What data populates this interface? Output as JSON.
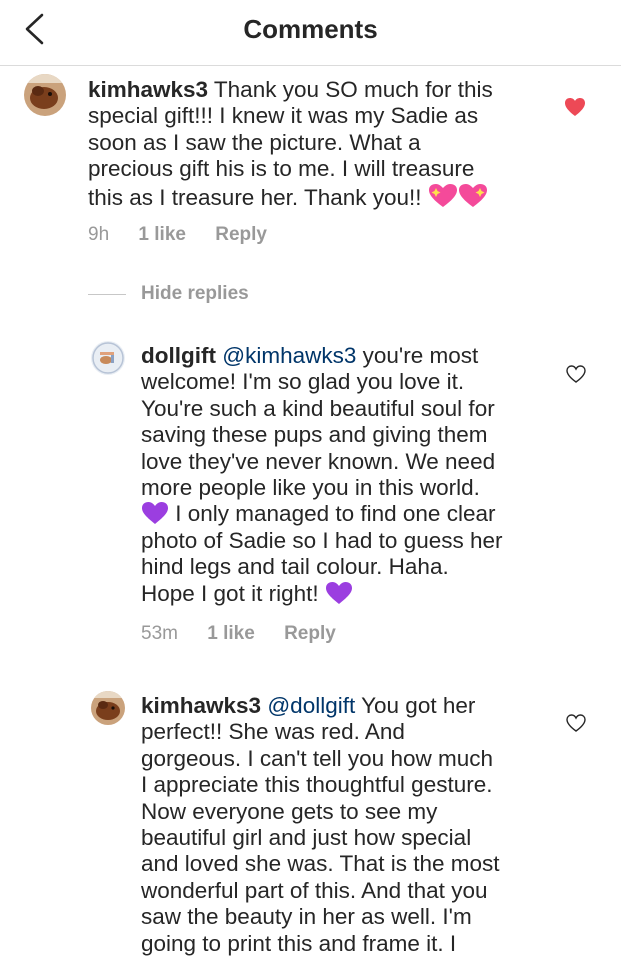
{
  "header": {
    "title": "Comments",
    "back_icon": "chevron-left-icon"
  },
  "comments": [
    {
      "username": "kimhawks3",
      "lines": [
        " Thank you SO much for this",
        "special gift!!! I knew it was my Sadie as",
        "soon as I saw the picture. What a",
        "precious gift his is to me. I will treasure",
        "this as I treasure her. Thank you!! "
      ],
      "emoji": "sparkling-heart-icon",
      "time": "9h",
      "likes": "1 like",
      "reply": "Reply",
      "liked": true,
      "heart_color": "#ed4956"
    },
    {
      "username": "dollgift",
      "mention": "@kimhawks3",
      "lines": [
        " you're most",
        "welcome! I'm so glad you love it.",
        "You're such a kind beautiful soul for",
        "saving these pups and giving them",
        "love they've never known. We need",
        "more people like you in this world.",
        " I only managed to find one clear",
        "photo of Sadie so I had to guess her",
        "hind legs and tail colour. Haha.",
        "Hope I got it right! "
      ],
      "emoji": "purple-heart-icon",
      "time": "53m",
      "likes": "1 like",
      "reply": "Reply",
      "liked": false
    },
    {
      "username": "kimhawks3",
      "mention": "@dollgift",
      "lines": [
        " You got her",
        "perfect!! She was red. And",
        "gorgeous. I can't tell you how much",
        "I appreciate this thoughtful gesture.",
        "Now everyone gets to see my",
        "beautiful girl and just how special",
        "and loved she was. That is the most",
        "wonderful part of this. And that you",
        "saw the beauty in her as well. I'm",
        "going to print this and frame it. I"
      ],
      "liked": false
    }
  ],
  "hide_replies": "Hide replies",
  "colors": {
    "mention": "#003569",
    "meta": "#999999",
    "liked_heart": "#ed4956",
    "purple_heart": "#9b3ee0",
    "sparkling_heart": "#f44a9a"
  }
}
